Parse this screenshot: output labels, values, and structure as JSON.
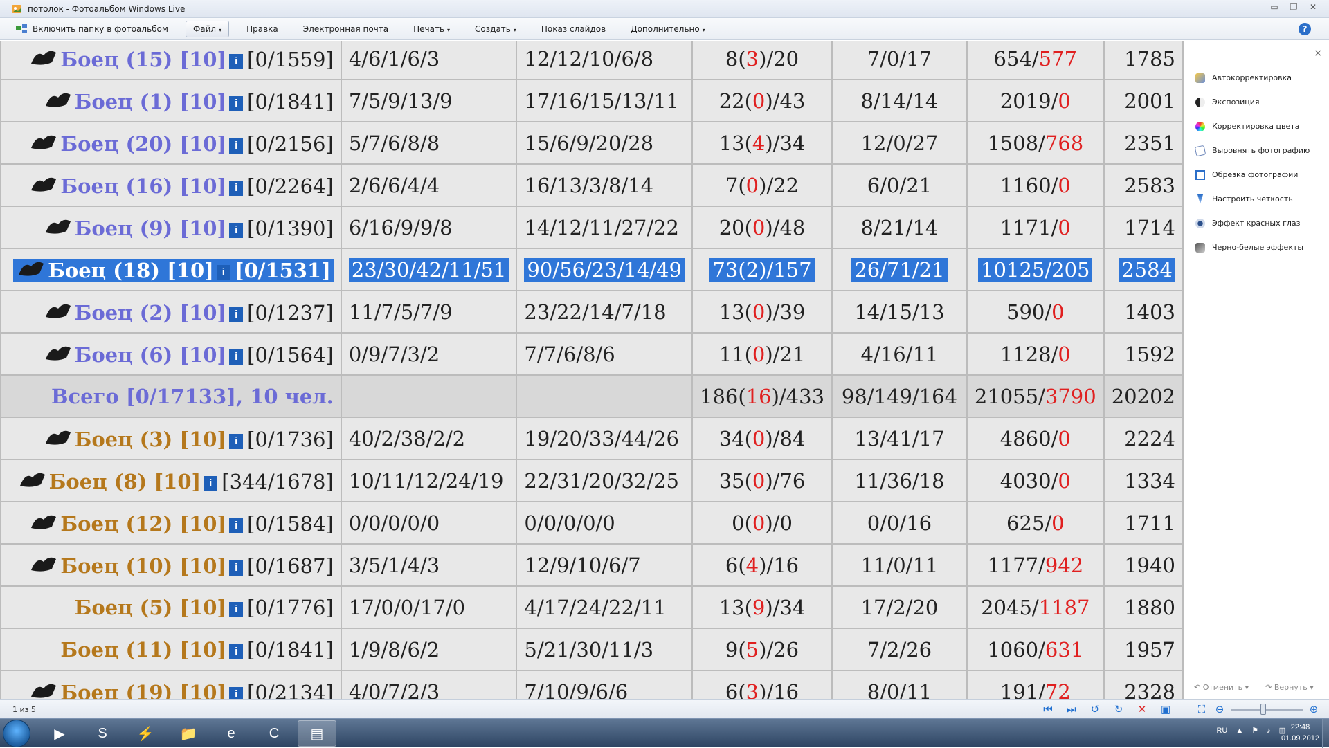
{
  "window": {
    "title": "потолок - Фотоальбом Windows Live",
    "controls": [
      "▭",
      "❐",
      "✕"
    ]
  },
  "menu": {
    "include_folder": "Включить папку в фотоальбом",
    "file": "Файл",
    "edit": "Правка",
    "email": "Электронная почта",
    "print": "Печать",
    "create": "Создать",
    "slideshow": "Показ слайдов",
    "extra": "Дополнительно",
    "help": "?"
  },
  "table": {
    "rows": [
      {
        "fighter": "Боец (15) [10]",
        "color": "blue",
        "points": "[0/1559]",
        "a": "4/6/1/6/3",
        "b": "12/12/10/6/8",
        "c1": "8(",
        "c2": "3",
        "c3": ")/20",
        "d": "7/0/17",
        "e1": "654/",
        "e2": "577",
        "f": "1785",
        "icon": "dragon-icon"
      },
      {
        "fighter": "Боец (1) [10]",
        "color": "blue",
        "points": "[0/1841]",
        "a": "7/5/9/13/9",
        "b": "17/16/15/13/11",
        "c1": "22(",
        "c2": "0",
        "c3": ")/43",
        "d": "8/14/14",
        "e1": "2019/",
        "e2": "0",
        "f": "2001",
        "icon": "bird-icon"
      },
      {
        "fighter": "Боец (20) [10]",
        "color": "blue",
        "points": "[0/2156]",
        "a": "5/7/6/8/8",
        "b": "15/6/9/20/28",
        "c1": "13(",
        "c2": "4",
        "c3": ")/34",
        "d": "12/0/27",
        "e1": "1508/",
        "e2": "768",
        "f": "2351",
        "icon": "cross-icon"
      },
      {
        "fighter": "Боец (16) [10]",
        "color": "blue",
        "points": "[0/2264]",
        "a": "2/6/6/4/4",
        "b": "16/13/3/8/14",
        "c1": "7(",
        "c2": "0",
        "c3": ")/22",
        "d": "6/0/21",
        "e1": "1160/",
        "e2": "0",
        "f": "2583",
        "icon": "eagle-icon"
      },
      {
        "fighter": "Боец (9) [10]",
        "color": "blue",
        "points": "[0/1390]",
        "a": "6/16/9/9/8",
        "b": "14/12/11/27/22",
        "c1": "20(",
        "c2": "0",
        "c3": ")/48",
        "d": "8/21/14",
        "e1": "1171/",
        "e2": "0",
        "f": "1714",
        "icon": "skull-icon"
      },
      {
        "fighter": "Боец (18) [10]",
        "color": "selected",
        "points": "[0/1531]",
        "a": "23/30/42/11/51",
        "b": "90/56/23/14/49",
        "c1": "73(",
        "c2": "2",
        "c3": ")/157",
        "d": "26/71/21",
        "e1": "10125/",
        "e2": "205",
        "f": "2584",
        "icon": "shield-icon"
      },
      {
        "fighter": "Боец (2) [10]",
        "color": "blue",
        "points": "[0/1237]",
        "a": "11/7/5/7/9",
        "b": "23/22/14/7/18",
        "c1": "13(",
        "c2": "0",
        "c3": ")/39",
        "d": "14/15/13",
        "e1": "590/",
        "e2": "0",
        "f": "1403",
        "icon": "star-icon"
      },
      {
        "fighter": "Боец (6) [10]",
        "color": "blue",
        "points": "[0/1564]",
        "a": "0/9/7/3/2",
        "b": "7/7/6/8/6",
        "c1": "11(",
        "c2": "0",
        "c3": ")/21",
        "d": "4/16/11",
        "e1": "1128/",
        "e2": "0",
        "f": "1592",
        "icon": "glyph-icon"
      }
    ],
    "total": {
      "label": "Всего [0/17133], 10 чел.",
      "c1": "186(",
      "c2": "16",
      "c3": ")/433",
      "d": "98/149/164",
      "e1": "21055/",
      "e2": "3790",
      "f": "20202"
    },
    "rows2": [
      {
        "fighter": "Боец (3) [10]",
        "color": "orange",
        "points": "[0/1736]",
        "a": "40/2/38/2/2",
        "b": "19/20/33/44/26",
        "c1": "34(",
        "c2": "0",
        "c3": ")/84",
        "d": "13/41/17",
        "e1": "4860/",
        "e2": "0",
        "f": "2224",
        "icon": "mask-icon"
      },
      {
        "fighter": "Боец (8) [10]",
        "color": "orange",
        "points": "[344/1678]",
        "a": "10/11/12/24/19",
        "b": "22/31/20/32/25",
        "c1": "35(",
        "c2": "0",
        "c3": ")/76",
        "d": "11/36/18",
        "e1": "4030/",
        "e2": "0",
        "f": "1334",
        "icon": "drop-icon"
      },
      {
        "fighter": "Боец (12) [10]",
        "color": "orange",
        "points": "[0/1584]",
        "a": "0/0/0/0/0",
        "b": "0/0/0/0/0",
        "c1": "0(",
        "c2": "0",
        "c3": ")/0",
        "d": "0/0/16",
        "e1": "625/",
        "e2": "0",
        "f": "1711",
        "icon": "bat-icon"
      },
      {
        "fighter": "Боец (10) [10]",
        "color": "orange",
        "points": "[0/1687]",
        "a": "3/5/1/4/3",
        "b": "12/9/10/6/7",
        "c1": "6(",
        "c2": "4",
        "c3": ")/16",
        "d": "11/0/11",
        "e1": "1177/",
        "e2": "942",
        "f": "1940",
        "icon": "hand-icon"
      },
      {
        "fighter": "Боец (5) [10]",
        "color": "orange",
        "points": "[0/1776]",
        "a": "17/0/0/17/0",
        "b": "4/17/24/22/11",
        "c1": "13(",
        "c2": "9",
        "c3": ")/34",
        "d": "17/2/20",
        "e1": "2045/",
        "e2": "1187",
        "f": "1880",
        "icon": ""
      },
      {
        "fighter": "Боец (11) [10]",
        "color": "orange",
        "points": "[0/1841]",
        "a": "1/9/8/6/2",
        "b": "5/21/30/11/3",
        "c1": "9(",
        "c2": "5",
        "c3": ")/26",
        "d": "7/2/26",
        "e1": "1060/",
        "e2": "631",
        "f": "1957",
        "icon": ""
      },
      {
        "fighter": "Боец (19) [10]",
        "color": "orange",
        "points": "[0/2134]",
        "a": "4/0/7/2/3",
        "b": "7/10/9/6/6",
        "c1": "6(",
        "c2": "3",
        "c3": ")/16",
        "d": "8/0/11",
        "e1": "191/",
        "e2": "72",
        "f": "2328",
        "icon": "face-icon"
      }
    ],
    "info_glyph": "i"
  },
  "fix_panel": {
    "close": "×",
    "items": [
      "Автокорректировка",
      "Экспозиция",
      "Корректировка цвета",
      "Выровнять фотографию",
      "Обрезка фотографии",
      "Настроить четкость",
      "Эффект красных глаз",
      "Черно-белые эффекты"
    ],
    "undo": "Отменить",
    "redo": "Вернуть"
  },
  "status": {
    "count": "1 из 5",
    "zoom_value": 0.45
  },
  "taskbar": {
    "lang": "RU",
    "time": "22:48",
    "date": "01.09.2012"
  },
  "colors": {
    "accent": "#2f76d8",
    "blue_name": "#6b6bd6",
    "orange_name": "#b5781c",
    "red": "#e02020"
  }
}
